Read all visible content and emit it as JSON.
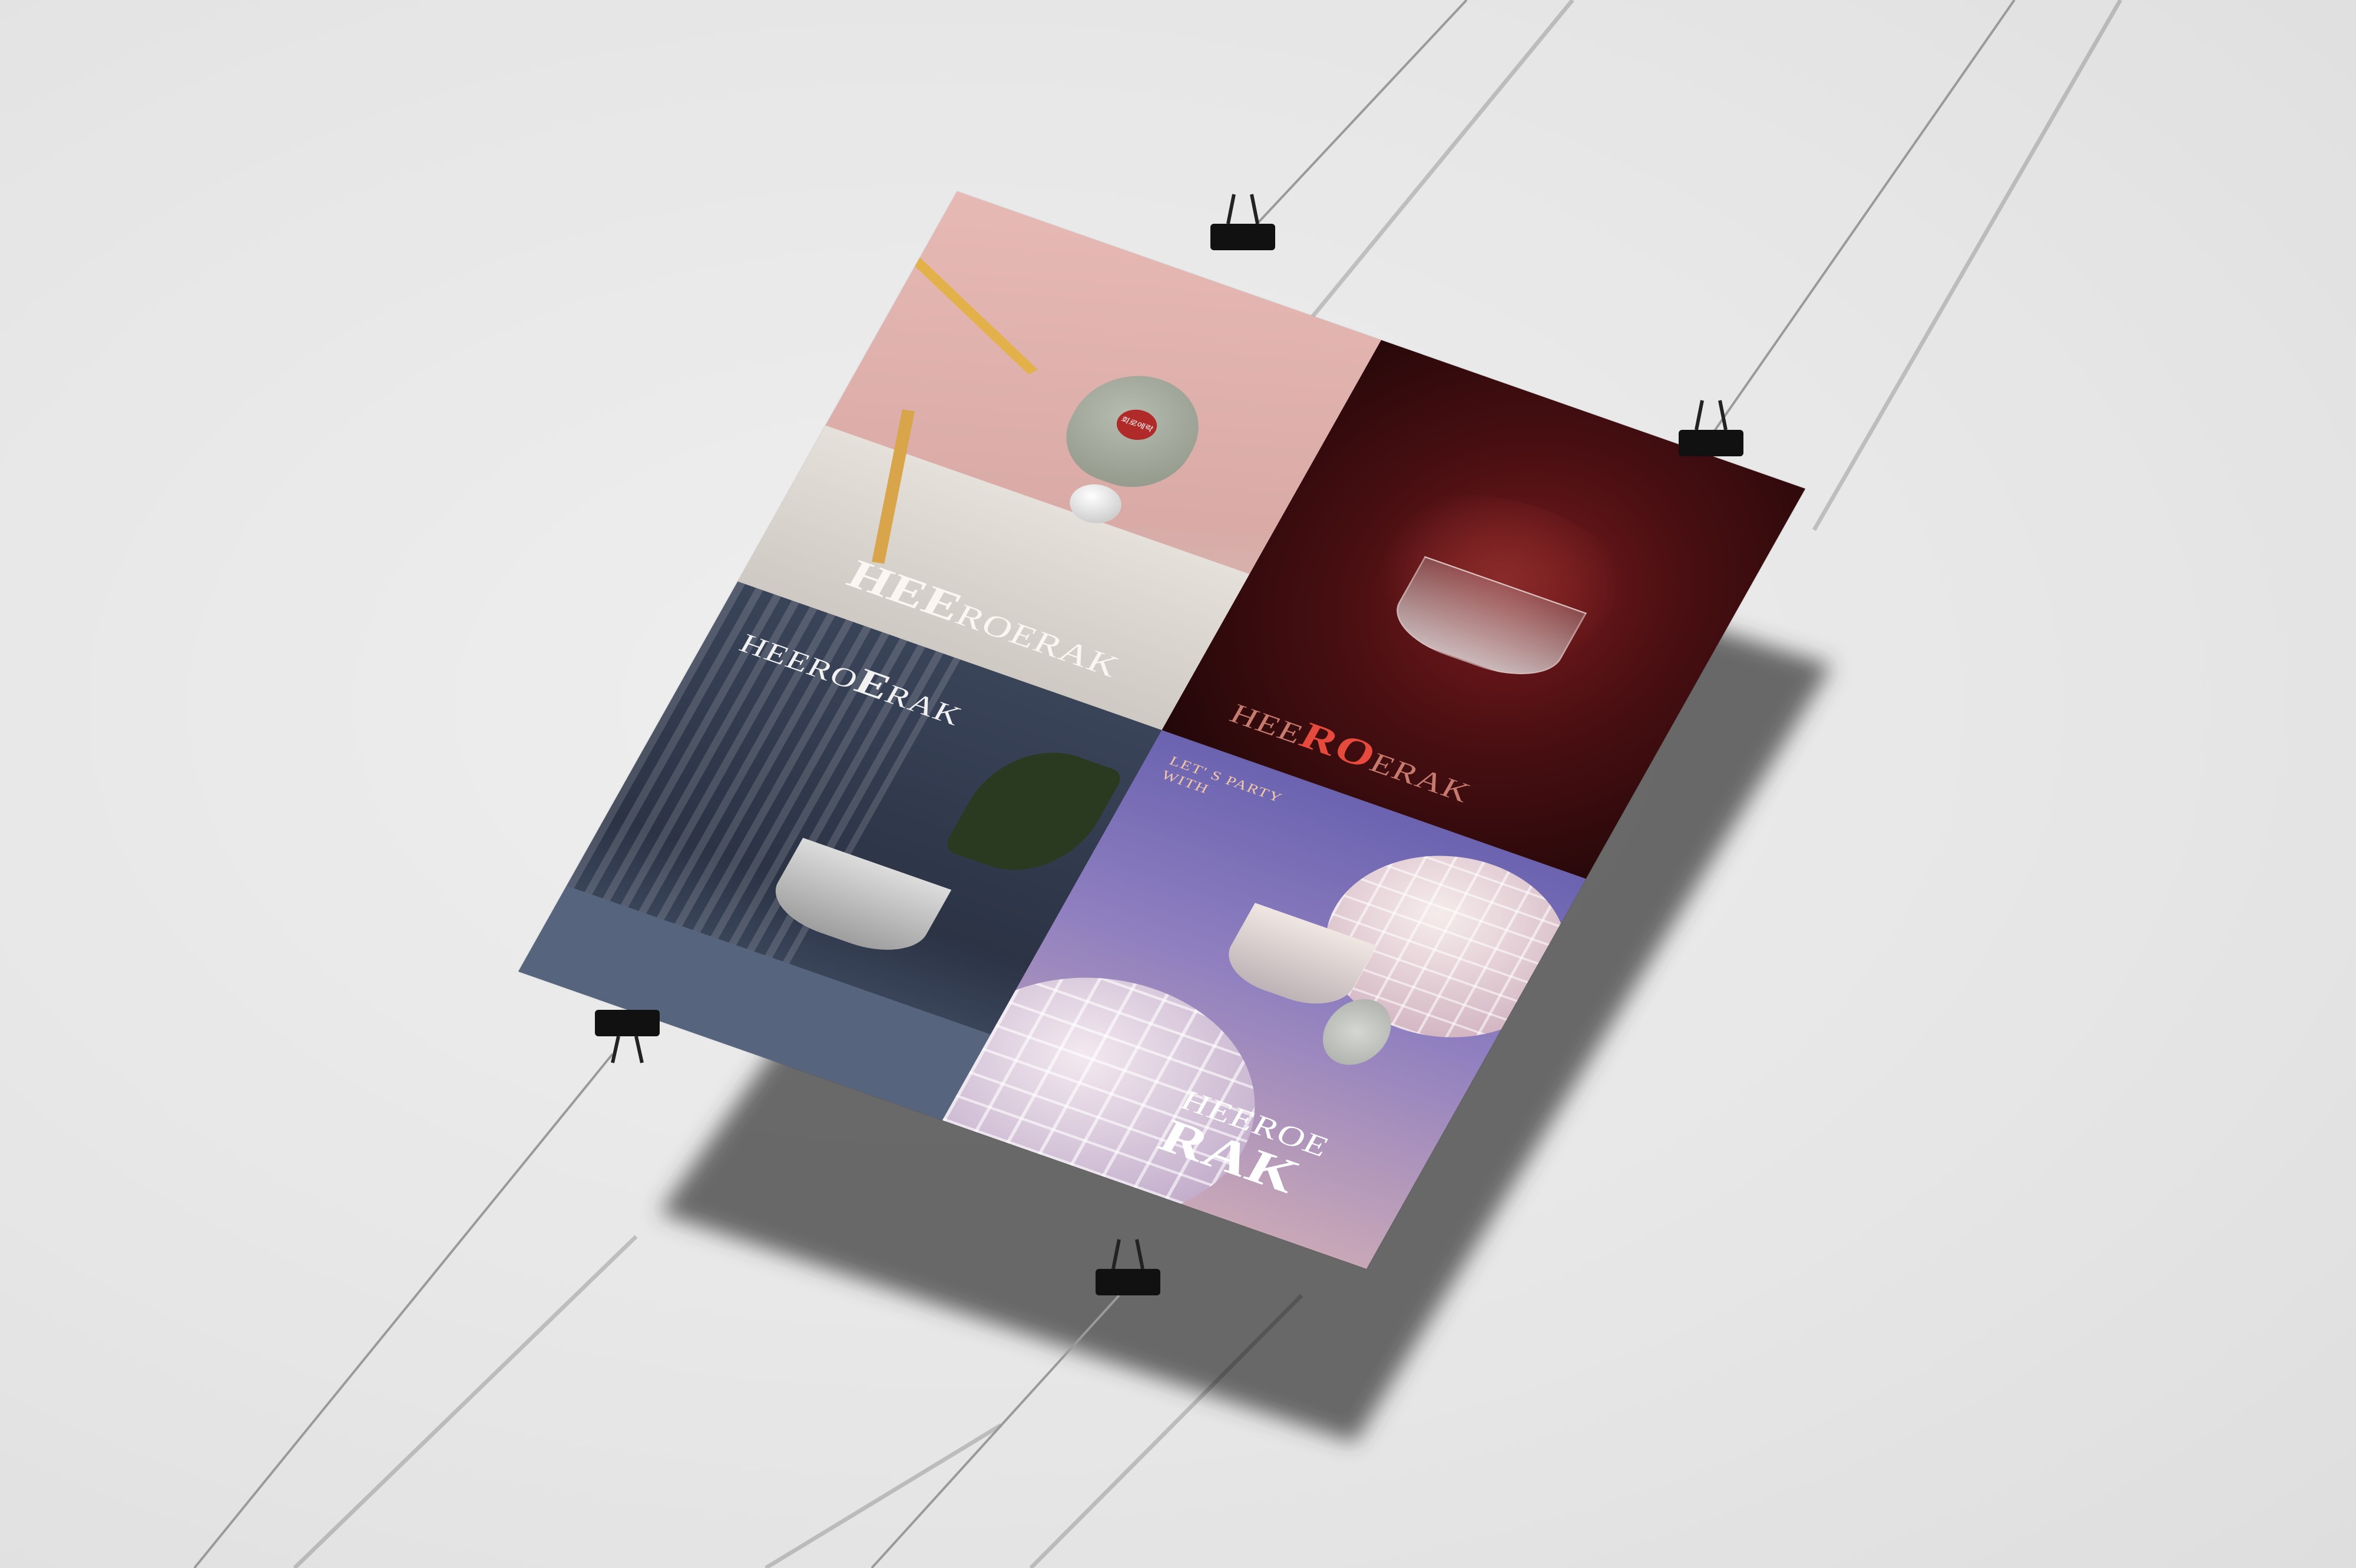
{
  "poster": {
    "panels": [
      {
        "id": "pink",
        "wordmark": {
          "lead": "HEE",
          "tail": "ROERAK"
        }
      },
      {
        "id": "red",
        "wordmark": {
          "head": "HEE",
          "mid": "RO",
          "tail": "ERAK"
        }
      },
      {
        "id": "navy",
        "wordmark_line1": "HEERO",
        "wordmark_mid": "E",
        "wordmark_tail": "RAK"
      },
      {
        "id": "purple",
        "tagline_line1": "LET' S PARTY",
        "tagline_line2": "WITH",
        "wordmark_line1": "HEEROE",
        "wordmark_line2": "RAK"
      }
    ],
    "lid_badge": "회로에락"
  },
  "colors": {
    "wall": "#e9e9e9",
    "pink": "#e2b4b0",
    "red": "#5a1316",
    "navy": "#2f374a",
    "purple": "#7b70b8",
    "clip": "#111111"
  },
  "icons": [
    "binder-clip-icon",
    "hanging-thread"
  ]
}
